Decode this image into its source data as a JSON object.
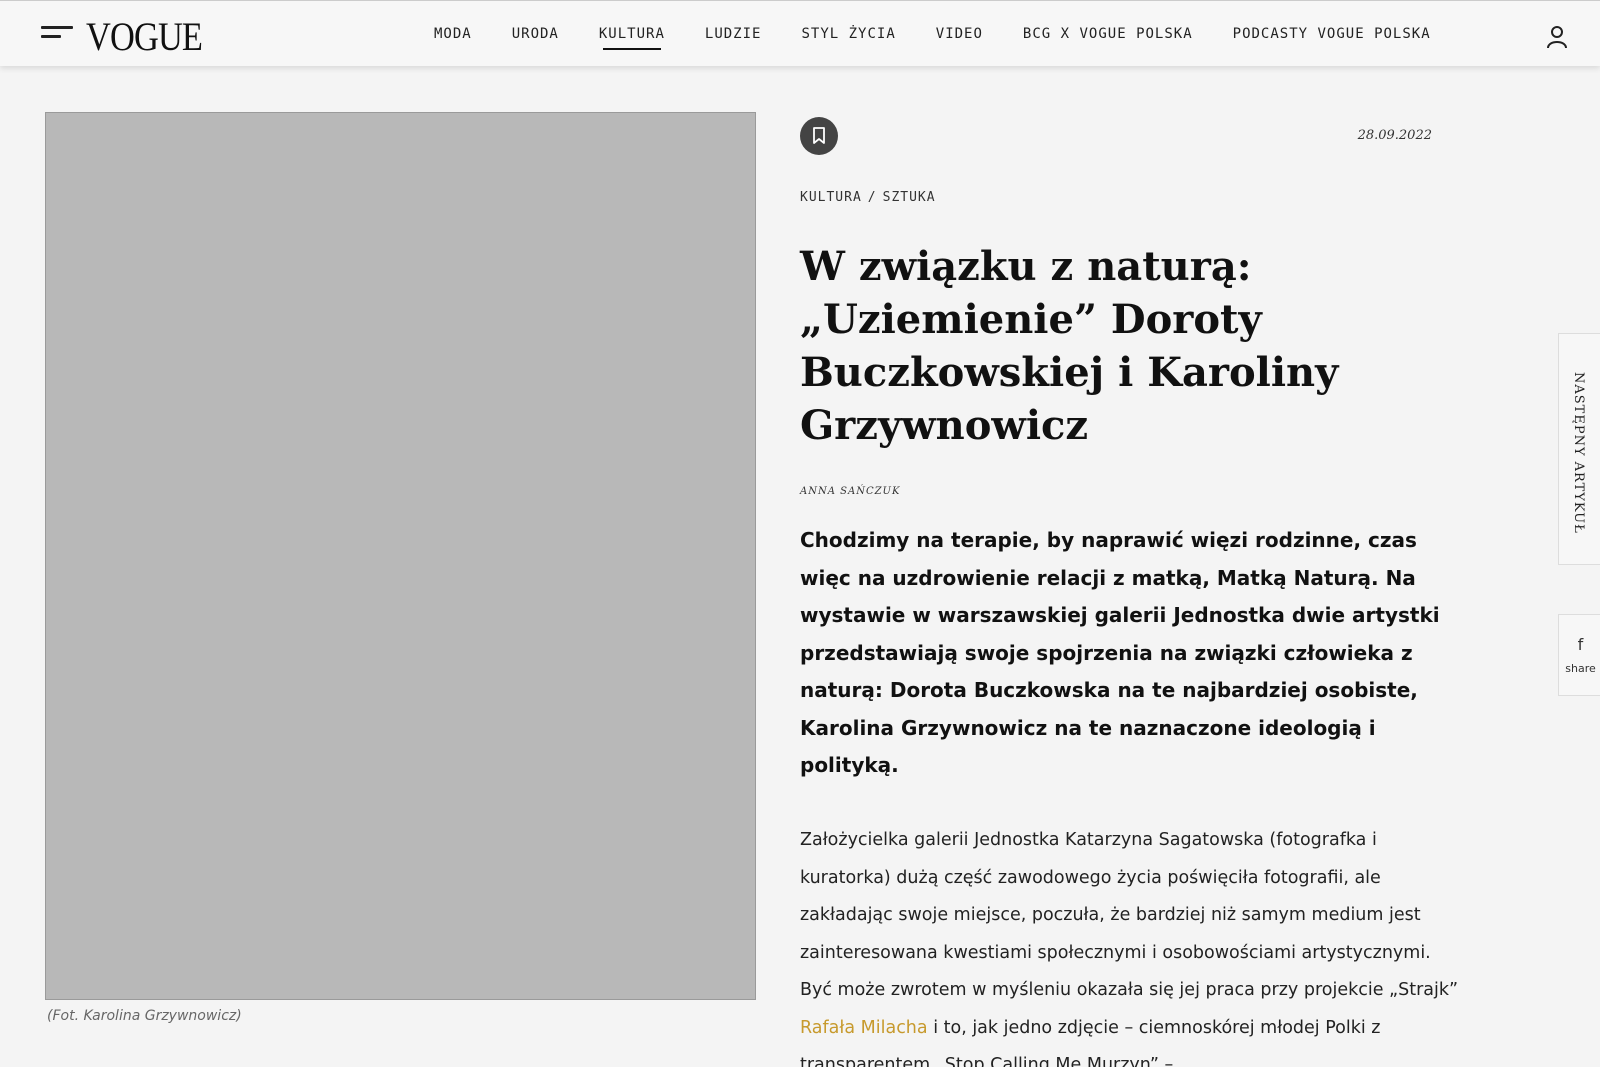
{
  "header": {
    "logo": "VOGUE",
    "nav": [
      {
        "label": "MODA",
        "active": false
      },
      {
        "label": "URODA",
        "active": false
      },
      {
        "label": "KULTURA",
        "active": true
      },
      {
        "label": "LUDZIE",
        "active": false
      },
      {
        "label": "STYL ŻYCIA",
        "active": false
      },
      {
        "label": "VIDEO",
        "active": false
      },
      {
        "label": "BCG X VOGUE POLSKA",
        "active": false
      },
      {
        "label": "PODCASTY VOGUE POLSKA",
        "active": false
      }
    ],
    "icons": {
      "menu": "hamburger-menu-icon",
      "account": "user-icon"
    }
  },
  "hero": {
    "caption": "(Fot. Karolina Grzywnowicz)"
  },
  "article": {
    "date": "28.09.2022",
    "breadcrumb": {
      "section": "KULTURA",
      "separator": "/",
      "subsection": "SZTUKA"
    },
    "title": "W związku z naturą: „Uziemienie” Doroty Buczkowskiej i Karoliny Grzywnowicz",
    "author": "Anna Sańczuk",
    "lead": "Chodzimy na terapie, by naprawić więzi rodzinne, czas więc na uzdrowienie relacji z matką, Matką Naturą. Na wystawie w warszawskiej galerii Jednostka dwie artystki przedstawiają swoje spojrzenia na związki człowieka z naturą: Dorota Buczkowska na te najbardziej osobiste, Karolina Grzywnowicz na te naznaczone ideologią i polityką.",
    "body_before_link": "Założycielka galerii Jednostka Katarzyna Sagatowska (fotografka i kuratorka) dużą część zawodowego życia poświęciła fotografii, ale zakładając swoje miejsce, poczuła, że bardziej niż samym medium jest zainteresowana kwestiami społecznymi i osobowościami artystycznymi. Być może zwrotem w myśleniu okazała się jej praca przy projekcie „Strajk” ",
    "body_link": "Rafała Milacha",
    "body_after_link": " i to, jak jedno zdjęcie – ciemnoskórej młodej Polki z transparentem „Stop Calling Me Murzyn” –"
  },
  "side": {
    "next_article": "NASTĘPNY ARTYKUŁ",
    "share_label": "share",
    "share_icon_glyph": "f"
  },
  "colors": {
    "link": "#c79a2d",
    "background": "#f4f4f4"
  }
}
